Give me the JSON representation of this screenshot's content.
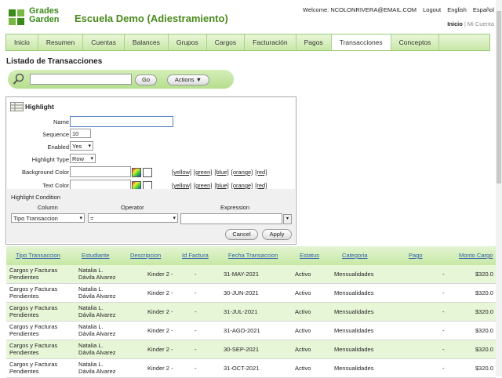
{
  "brand": {
    "logo_line1": "Grades",
    "logo_line2": "Garden",
    "title": "Escuela Demo (Adiestramiento)"
  },
  "header": {
    "welcome": "Welcome: NCOLONRIVERA@EMAIL.COM",
    "logout": "Logout",
    "english": "English",
    "spanish": "Español",
    "inicio": "Inicio",
    "sep": "|",
    "mi_cuenta": "Mi Cuenta"
  },
  "tabs": [
    "Inicio",
    "Resumen",
    "Cuentas",
    "Balances",
    "Grupos",
    "Cargos",
    "Facturación",
    "Pagos",
    "Transacciones",
    "Conceptos"
  ],
  "page_title": "Listado de Transacciones",
  "search": {
    "go": "Go",
    "actions": "Actions"
  },
  "highlight": {
    "title": "Highlight",
    "name_label": "Name",
    "name_value": "",
    "sequence_label": "Sequence",
    "sequence_value": "10",
    "enabled_label": "Enabled",
    "enabled_value": "Yes",
    "type_label": "Highlight Type",
    "type_value": "Row",
    "bg_label": "Background Color",
    "text_label": "Text Color",
    "color_links": [
      "[yellow]",
      "[green]",
      "[blue]",
      "[orange]",
      "[red]"
    ],
    "condition_title": "Highlight Condition",
    "col_header": "Column",
    "op_header": "Operator",
    "expr_header": "Expression",
    "col_value": "Tipo Transaccion",
    "op_value": "=",
    "cancel": "Cancel",
    "apply": "Apply"
  },
  "table": {
    "headers": [
      "Tipo Transaccion",
      "Estudiante",
      "Descripcion",
      "Id Factura",
      "Fecha Transaccion",
      "Estatus",
      "Categoria",
      "Pago",
      "Monto Cargo"
    ],
    "rows": [
      {
        "tipo1": "Cargos y Facturas",
        "tipo2": "Pendientes",
        "est1": "Natalia L.",
        "est2": "Dávila Alvarez",
        "desc": "Kinder 2 -",
        "id": "-",
        "fecha": "31-MAY-2021",
        "estatus": "Activo",
        "cat": "Mensualidades",
        "pago": "-",
        "monto": "$320.0"
      },
      {
        "tipo1": "Cargos y Facturas",
        "tipo2": "Pendientes",
        "est1": "Natalia L.",
        "est2": "Dávila Alvarez",
        "desc": "Kinder 2 -",
        "id": "-",
        "fecha": "30-JUN-2021",
        "estatus": "Activo",
        "cat": "Mensualidades",
        "pago": "-",
        "monto": "$320.0"
      },
      {
        "tipo1": "Cargos y Facturas",
        "tipo2": "Pendientes",
        "est1": "Natalia L.",
        "est2": "Dávila Alvarez",
        "desc": "Kinder 2 -",
        "id": "-",
        "fecha": "31-JUL-2021",
        "estatus": "Activo",
        "cat": "Mensualidades",
        "pago": "-",
        "monto": "$320.0"
      },
      {
        "tipo1": "Cargos y Facturas",
        "tipo2": "Pendientes",
        "est1": "Natalia L.",
        "est2": "Dávila Alvarez",
        "desc": "Kinder 2 -",
        "id": "-",
        "fecha": "31-AGO-2021",
        "estatus": "Activo",
        "cat": "Mensualidades",
        "pago": "-",
        "monto": "$320.0"
      },
      {
        "tipo1": "Cargos y Facturas",
        "tipo2": "Pendientes",
        "est1": "Natalia L.",
        "est2": "Dávila Alvarez",
        "desc": "Kinder 2 -",
        "id": "-",
        "fecha": "30-SEP-2021",
        "estatus": "Activo",
        "cat": "Mensualidades",
        "pago": "-",
        "monto": "$320.0"
      },
      {
        "tipo1": "Cargos y Facturas",
        "tipo2": "Pendientes",
        "est1": "Natalia L.",
        "est2": "Dávila Alvarez",
        "desc": "Kinder 2 -",
        "id": "-",
        "fecha": "31-OCT-2021",
        "estatus": "Activo",
        "cat": "Mensualidades",
        "pago": "-",
        "monto": "$320.0"
      }
    ]
  },
  "colors": {
    "accent_green": "#c7e8a5",
    "alt_row": "#e8f6d8",
    "link_blue": "#2f5fa8"
  }
}
